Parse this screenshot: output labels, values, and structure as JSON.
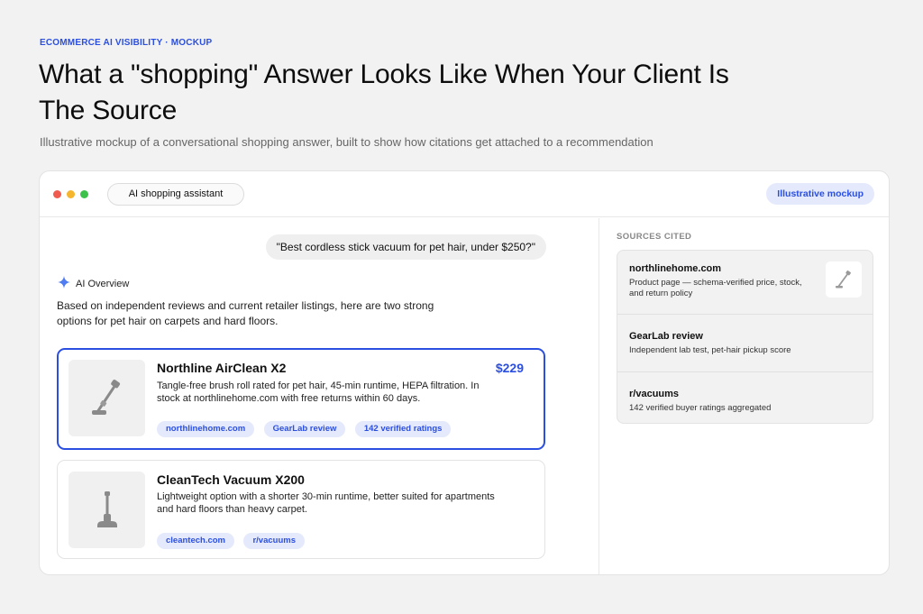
{
  "page": {
    "eyebrow": "ECOMMERCE AI VISIBILITY · MOCKUP",
    "headline": "What a \"shopping\" Answer Looks Like When Your Client Is The Source",
    "subhead": "Illustrative mockup of a conversational shopping answer, built to show how citations get attached to a recommendation"
  },
  "window": {
    "app_label": "AI shopping assistant",
    "badge": "Illustrative mockup",
    "traffic_lights": {
      "red": "#f05b4f",
      "yellow": "#f5b52d",
      "green": "#3cc24a"
    }
  },
  "chat": {
    "query": "\"Best cordless stick vacuum for pet hair, under $250?\"",
    "ai_label": "AI Overview",
    "intro": "Based on independent reviews and current retailer listings, here are two strong options for pet hair on carpets and hard floors.",
    "products": [
      {
        "title": "Northline AirClean X2",
        "price": "$229",
        "description": "Tangle-free brush roll rated for pet hair, 45-min runtime, HEPA filtration. In stock at northlinehome.com with free returns within 60 days.",
        "chips": [
          "northlinehome.com",
          "GearLab review",
          "142 verified ratings"
        ],
        "icon": "stick-vacuum-icon"
      },
      {
        "title": "CleanTech Vacuum X200",
        "description": "Lightweight option with a shorter 30-min runtime, better suited for apartments and hard floors than heavy carpet.",
        "chips": [
          "cleantech.com",
          "r/vacuums"
        ],
        "icon": "upright-vacuum-icon"
      }
    ]
  },
  "sources": {
    "label": "SOURCES CITED",
    "items": [
      {
        "name": "northlinehome.com",
        "description": "Product page — schema-verified price, stock, and return policy"
      },
      {
        "name": "GearLab review",
        "description": "Independent lab test, pet-hair pickup score"
      },
      {
        "name": "r/vacuums",
        "description": "142 verified buyer ratings aggregated"
      }
    ]
  },
  "colors": {
    "accent": "#2b4fe0",
    "chip_bg": "#e4e9fc",
    "page_bg": "#f2f2f2"
  }
}
